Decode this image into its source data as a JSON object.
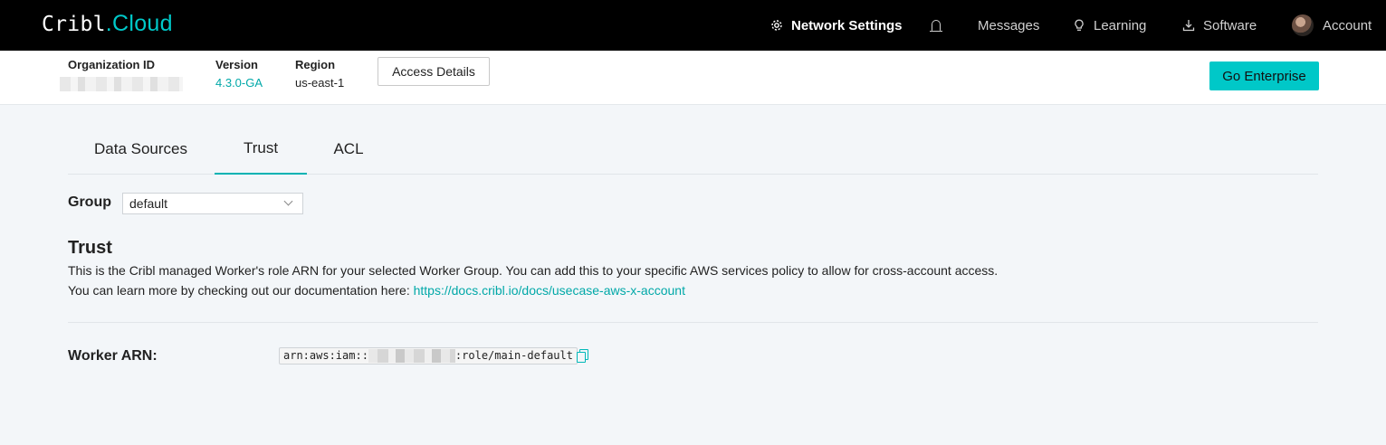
{
  "brand": {
    "logo_part1": "Cribl",
    "logo_part2": ".Cloud"
  },
  "nav": {
    "network_settings": "Network Settings",
    "notifications_icon": "bell-icon",
    "messages": "Messages",
    "learning": "Learning",
    "software": "Software",
    "account": "Account"
  },
  "info": {
    "org_label": "Organization ID",
    "version_label": "Version",
    "version_value": "4.3.0-GA",
    "region_label": "Region",
    "region_value": "us-east-1",
    "access_details": "Access Details",
    "go_enterprise": "Go Enterprise"
  },
  "tabs": [
    {
      "label": "Data Sources",
      "active": false
    },
    {
      "label": "Trust",
      "active": true
    },
    {
      "label": "ACL",
      "active": false
    }
  ],
  "group": {
    "label": "Group",
    "selected": "default"
  },
  "trust": {
    "title": "Trust",
    "line1": "This is the Cribl managed Worker's role ARN for your selected Worker Group. You can add this to your specific AWS services policy to allow for cross-account access.",
    "line2_prefix": "You can learn more by checking out our documentation here: ",
    "doc_link": "https://docs.cribl.io/docs/usecase-aws-x-account"
  },
  "arn": {
    "label": "Worker ARN:",
    "prefix": "arn:aws:iam::",
    "suffix": ":role/main-default"
  },
  "colors": {
    "accent": "#00c8c8",
    "link": "#00a8a8",
    "nav_bg": "#000000"
  }
}
